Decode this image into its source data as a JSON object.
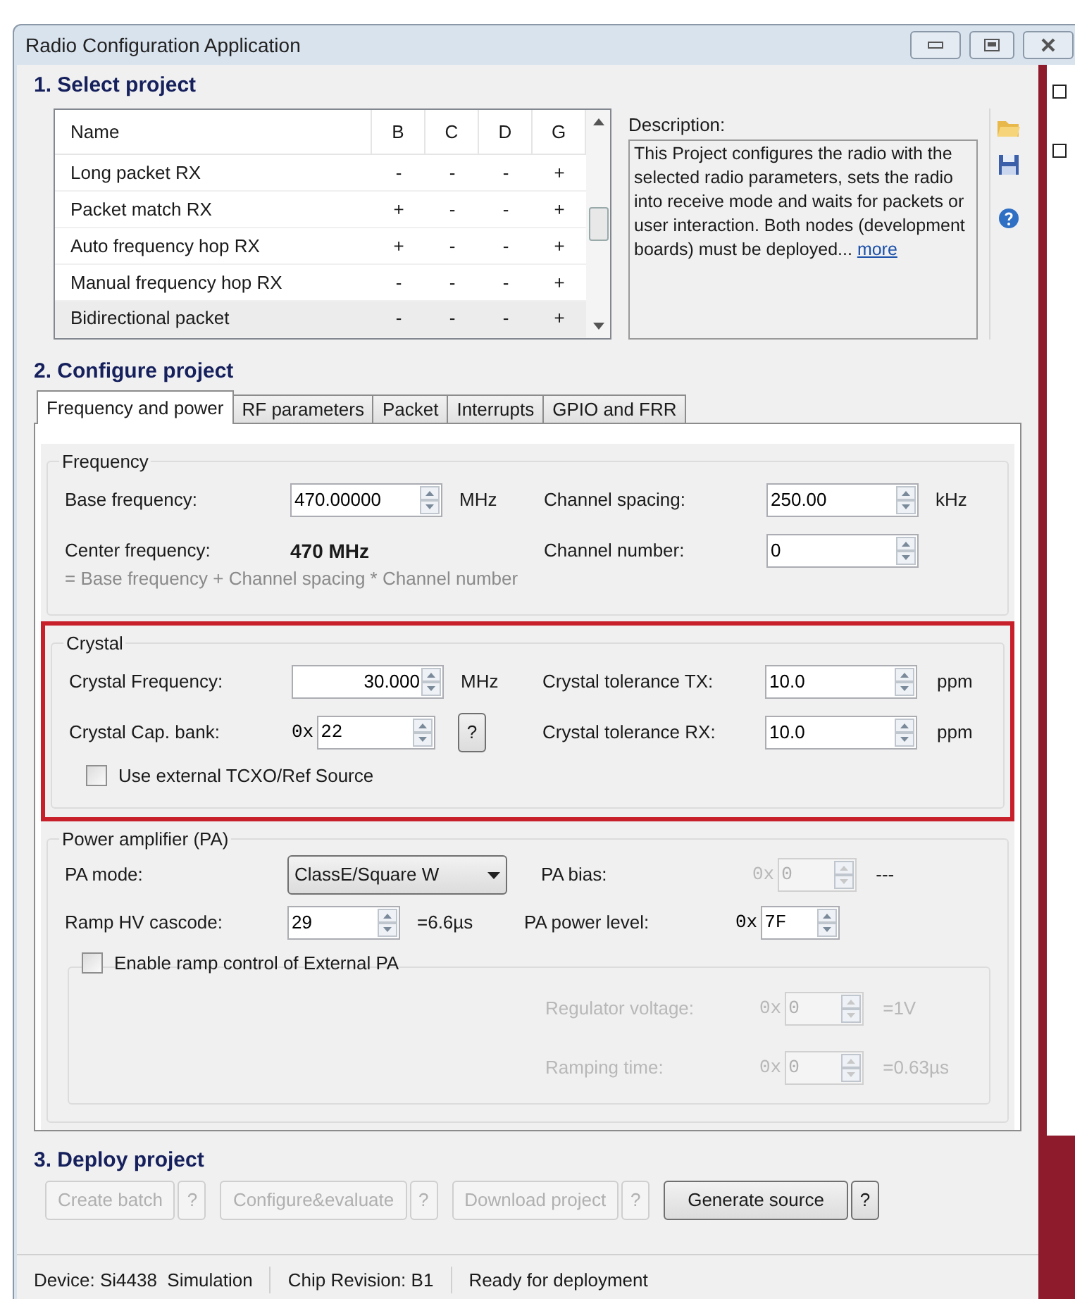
{
  "window": {
    "title": "Radio Configuration Application"
  },
  "select_project": {
    "title": "1. Select project",
    "columns": [
      "Name",
      "B",
      "C",
      "D",
      "G"
    ],
    "rows": [
      {
        "cells": [
          "Long packet RX",
          "-",
          "-",
          "-",
          "+"
        ],
        "selected": false
      },
      {
        "cells": [
          "Packet match RX",
          "+",
          "-",
          "-",
          "+"
        ],
        "selected": false
      },
      {
        "cells": [
          "Auto frequency hop RX",
          "+",
          "-",
          "-",
          "+"
        ],
        "selected": false
      },
      {
        "cells": [
          "Manual frequency hop RX",
          "-",
          "-",
          "-",
          "+"
        ],
        "selected": false
      },
      {
        "cells": [
          "Bidirectional packet",
          "-",
          "-",
          "-",
          "+"
        ],
        "selected": true
      }
    ],
    "description_label": "Description:",
    "description": "This Project configures the radio with the selected radio parameters, sets the radio into receive mode and waits for packets or user interaction. Both nodes (development boards) must be deployed...",
    "more_link": "more"
  },
  "configure_project": {
    "title": "2. Configure project",
    "tabs": [
      {
        "label": "Frequency and power",
        "selected": true
      },
      {
        "label": "RF parameters",
        "selected": false
      },
      {
        "label": "Packet",
        "selected": false
      },
      {
        "label": "Interrupts",
        "selected": false
      },
      {
        "label": "GPIO and FRR",
        "selected": false
      }
    ],
    "frequency": {
      "title": "Frequency",
      "base_frequency": {
        "label": "Base frequency:",
        "value": "470.00000",
        "unit": "MHz"
      },
      "channel_spacing": {
        "label": "Channel spacing:",
        "value": "250.00",
        "unit": "kHz"
      },
      "center_frequency": {
        "label": "Center frequency:",
        "value": "470 MHz"
      },
      "channel_number": {
        "label": "Channel number:",
        "value": "0"
      },
      "formula": "= Base frequency + Channel spacing * Channel number"
    },
    "crystal": {
      "title": "Crystal",
      "highlighted": true,
      "crystal_frequency": {
        "label": "Crystal Frequency:",
        "value": "30.000",
        "unit": "MHz"
      },
      "cap_bank": {
        "label": "Crystal Cap. bank:",
        "prefix": "0x",
        "value": "22",
        "help": "?"
      },
      "tolerance_tx": {
        "label": "Crystal tolerance TX:",
        "value": "10.0",
        "unit": "ppm"
      },
      "tolerance_rx": {
        "label": "Crystal tolerance RX:",
        "value": "10.0",
        "unit": "ppm"
      },
      "tcxo": {
        "label": "Use external TCXO/Ref Source",
        "checked": false
      }
    },
    "power_amplifier": {
      "title": "Power amplifier (PA)",
      "pa_mode": {
        "label": "PA mode:",
        "value": "ClassE/Square W"
      },
      "ramp_hv": {
        "label": "Ramp HV cascode:",
        "value": "29",
        "note": "=6.6µs"
      },
      "pa_bias": {
        "label": "PA bias:",
        "prefix": "0x",
        "value": "0",
        "note": "---",
        "disabled": true
      },
      "pa_power": {
        "label": "PA power level:",
        "prefix": "0x",
        "value": "7F",
        "disabled": false
      },
      "external_ramp": {
        "label": "Enable ramp control of External PA",
        "checked": false
      },
      "regulator_voltage": {
        "label": "Regulator voltage:",
        "prefix": "0x",
        "value": "0",
        "note": "=1V",
        "disabled": true
      },
      "ramping_time": {
        "label": "Ramping time:",
        "prefix": "0x",
        "value": "0",
        "note": "=0.63µs",
        "disabled": true
      }
    }
  },
  "deploy_project": {
    "title": "3. Deploy project",
    "buttons": [
      {
        "label": "Create batch",
        "help": "?",
        "disabled": true
      },
      {
        "label": "Configure&evaluate",
        "help": "?",
        "disabled": true
      },
      {
        "label": "Download project",
        "help": "?",
        "disabled": true
      },
      {
        "label": "Generate source",
        "help": "?",
        "disabled": false
      }
    ]
  },
  "status_bar": [
    "Device: Si4438  Simulation",
    "Chip Revision: B1",
    "Ready for deployment"
  ]
}
